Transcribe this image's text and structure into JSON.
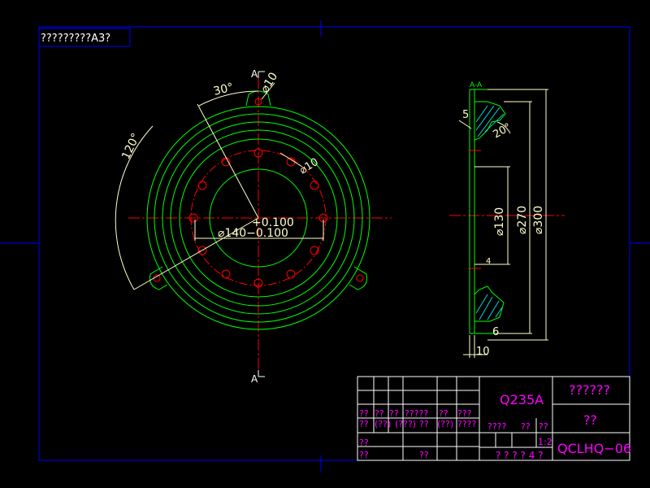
{
  "sheet": {
    "note": "?????????A3?",
    "colors": {
      "border": "#0000ff",
      "outline": "#00ff00",
      "hidden": "#ffff00",
      "center": "#ff0000",
      "dimension": "#ffffcc",
      "titleblock_text": "#ff00ff",
      "titleblock_lines": "#ffffff"
    }
  },
  "front_view": {
    "section_top": "A",
    "section_bottom": "A",
    "angle_small": "30°",
    "angle_large": "120°",
    "hole_small": "⌀10",
    "hole_bolt": "⌀10",
    "tol_upper": "+0.100",
    "bore": "⌀140−0.100"
  },
  "side_view": {
    "section_label": "A-A",
    "dim_chamfer": "5",
    "dim_angle": "20°",
    "dim_d130": "⌀130",
    "dim_d270": "⌀270",
    "dim_d300": "⌀300",
    "dim_thickness": "6",
    "dim_base": "10",
    "dim_mark": "4"
  },
  "title_block": {
    "material": "Q235A",
    "part_name": "??????",
    "unit": "??",
    "scale": "1:2",
    "drawing_no": "QCLHQ−06",
    "row_a": [
      "??",
      "??",
      "??",
      "?????",
      "??",
      "???"
    ],
    "row_b": [
      "??",
      "(??)",
      "(???)",
      "??",
      "(??)",
      "????"
    ],
    "row_c": [
      "????",
      "??",
      "??"
    ],
    "sheet_info": "? ? ? ? 4 ?",
    "left_c": "??",
    "left_d": "??",
    "left_e": "??"
  }
}
